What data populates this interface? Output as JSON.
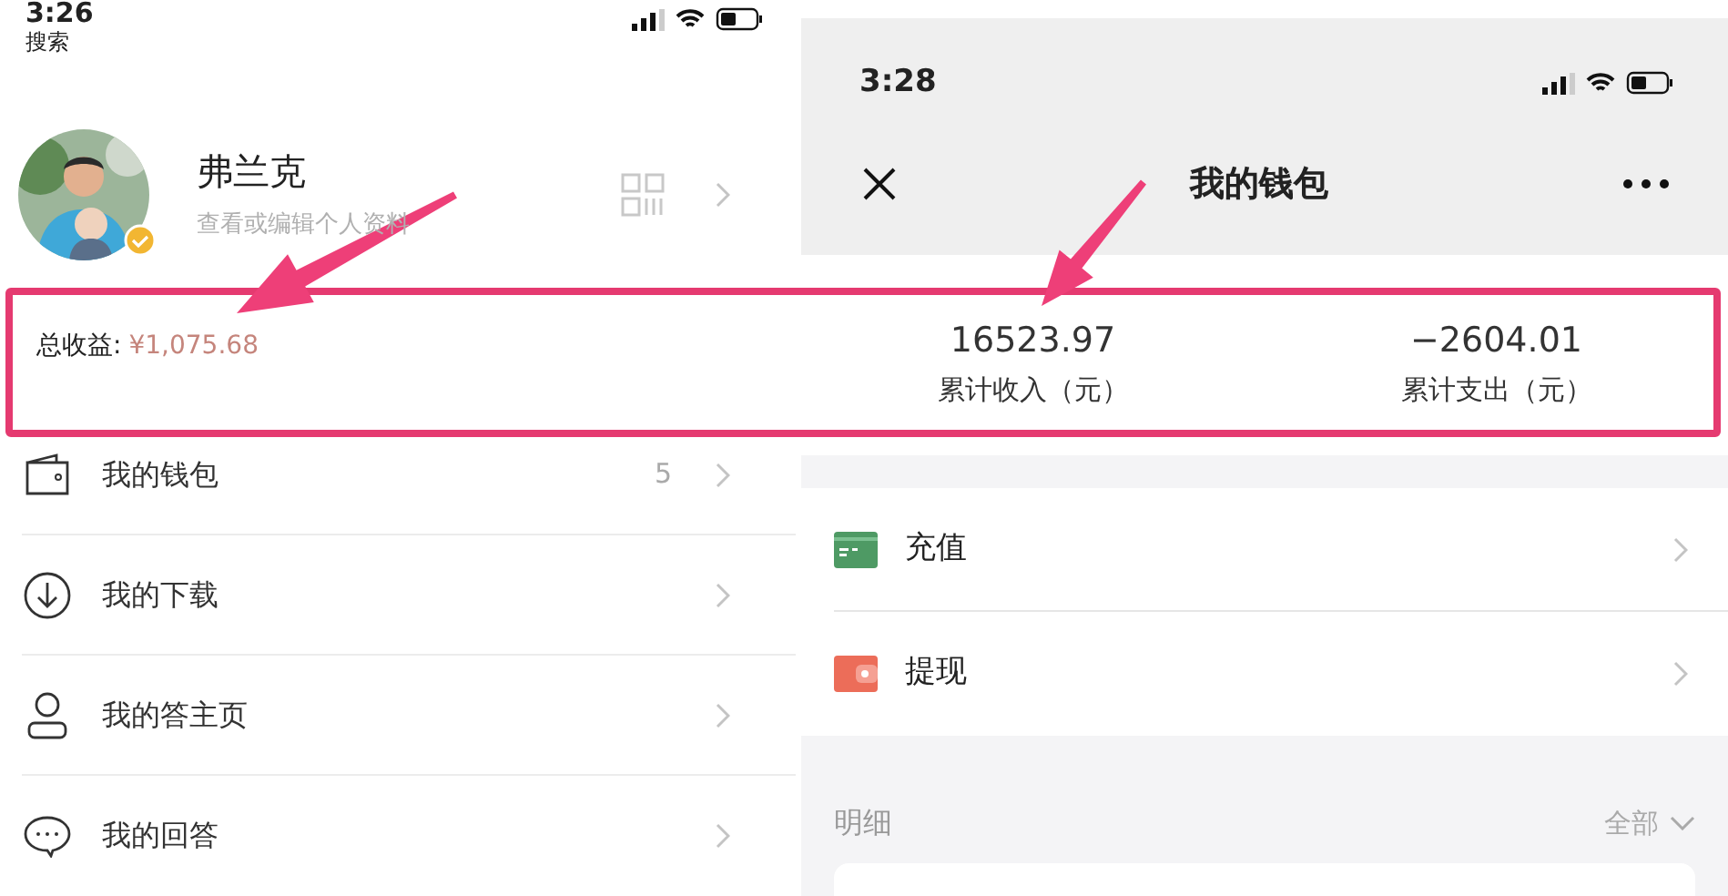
{
  "left_screen": {
    "status_bar": {
      "time": "3:26",
      "back_label": "搜索"
    },
    "profile": {
      "name": "弗兰克",
      "subtitle": "查看或编辑个人资料",
      "verified": true
    },
    "total_earnings": {
      "label": "总收益:",
      "amount": "¥1,075.68"
    },
    "menu": [
      {
        "kind": "wallet",
        "label": "我的钱包",
        "badge": "5"
      },
      {
        "kind": "download",
        "label": "我的下载"
      },
      {
        "kind": "person",
        "label": "我的答主页"
      },
      {
        "kind": "chat",
        "label": "我的回答"
      }
    ]
  },
  "right_screen": {
    "status_bar": {
      "time": "3:28"
    },
    "nav": {
      "title": "我的钱包"
    },
    "stats": [
      {
        "value": "16523.97",
        "label": "累计收入（元）"
      },
      {
        "value": "−2604.01",
        "label": "累计支出（元）"
      }
    ],
    "actions": [
      {
        "kind": "recharge",
        "label": "充值"
      },
      {
        "kind": "withdraw",
        "label": "提现"
      }
    ],
    "details": {
      "title": "明细",
      "filter": "全部"
    }
  }
}
